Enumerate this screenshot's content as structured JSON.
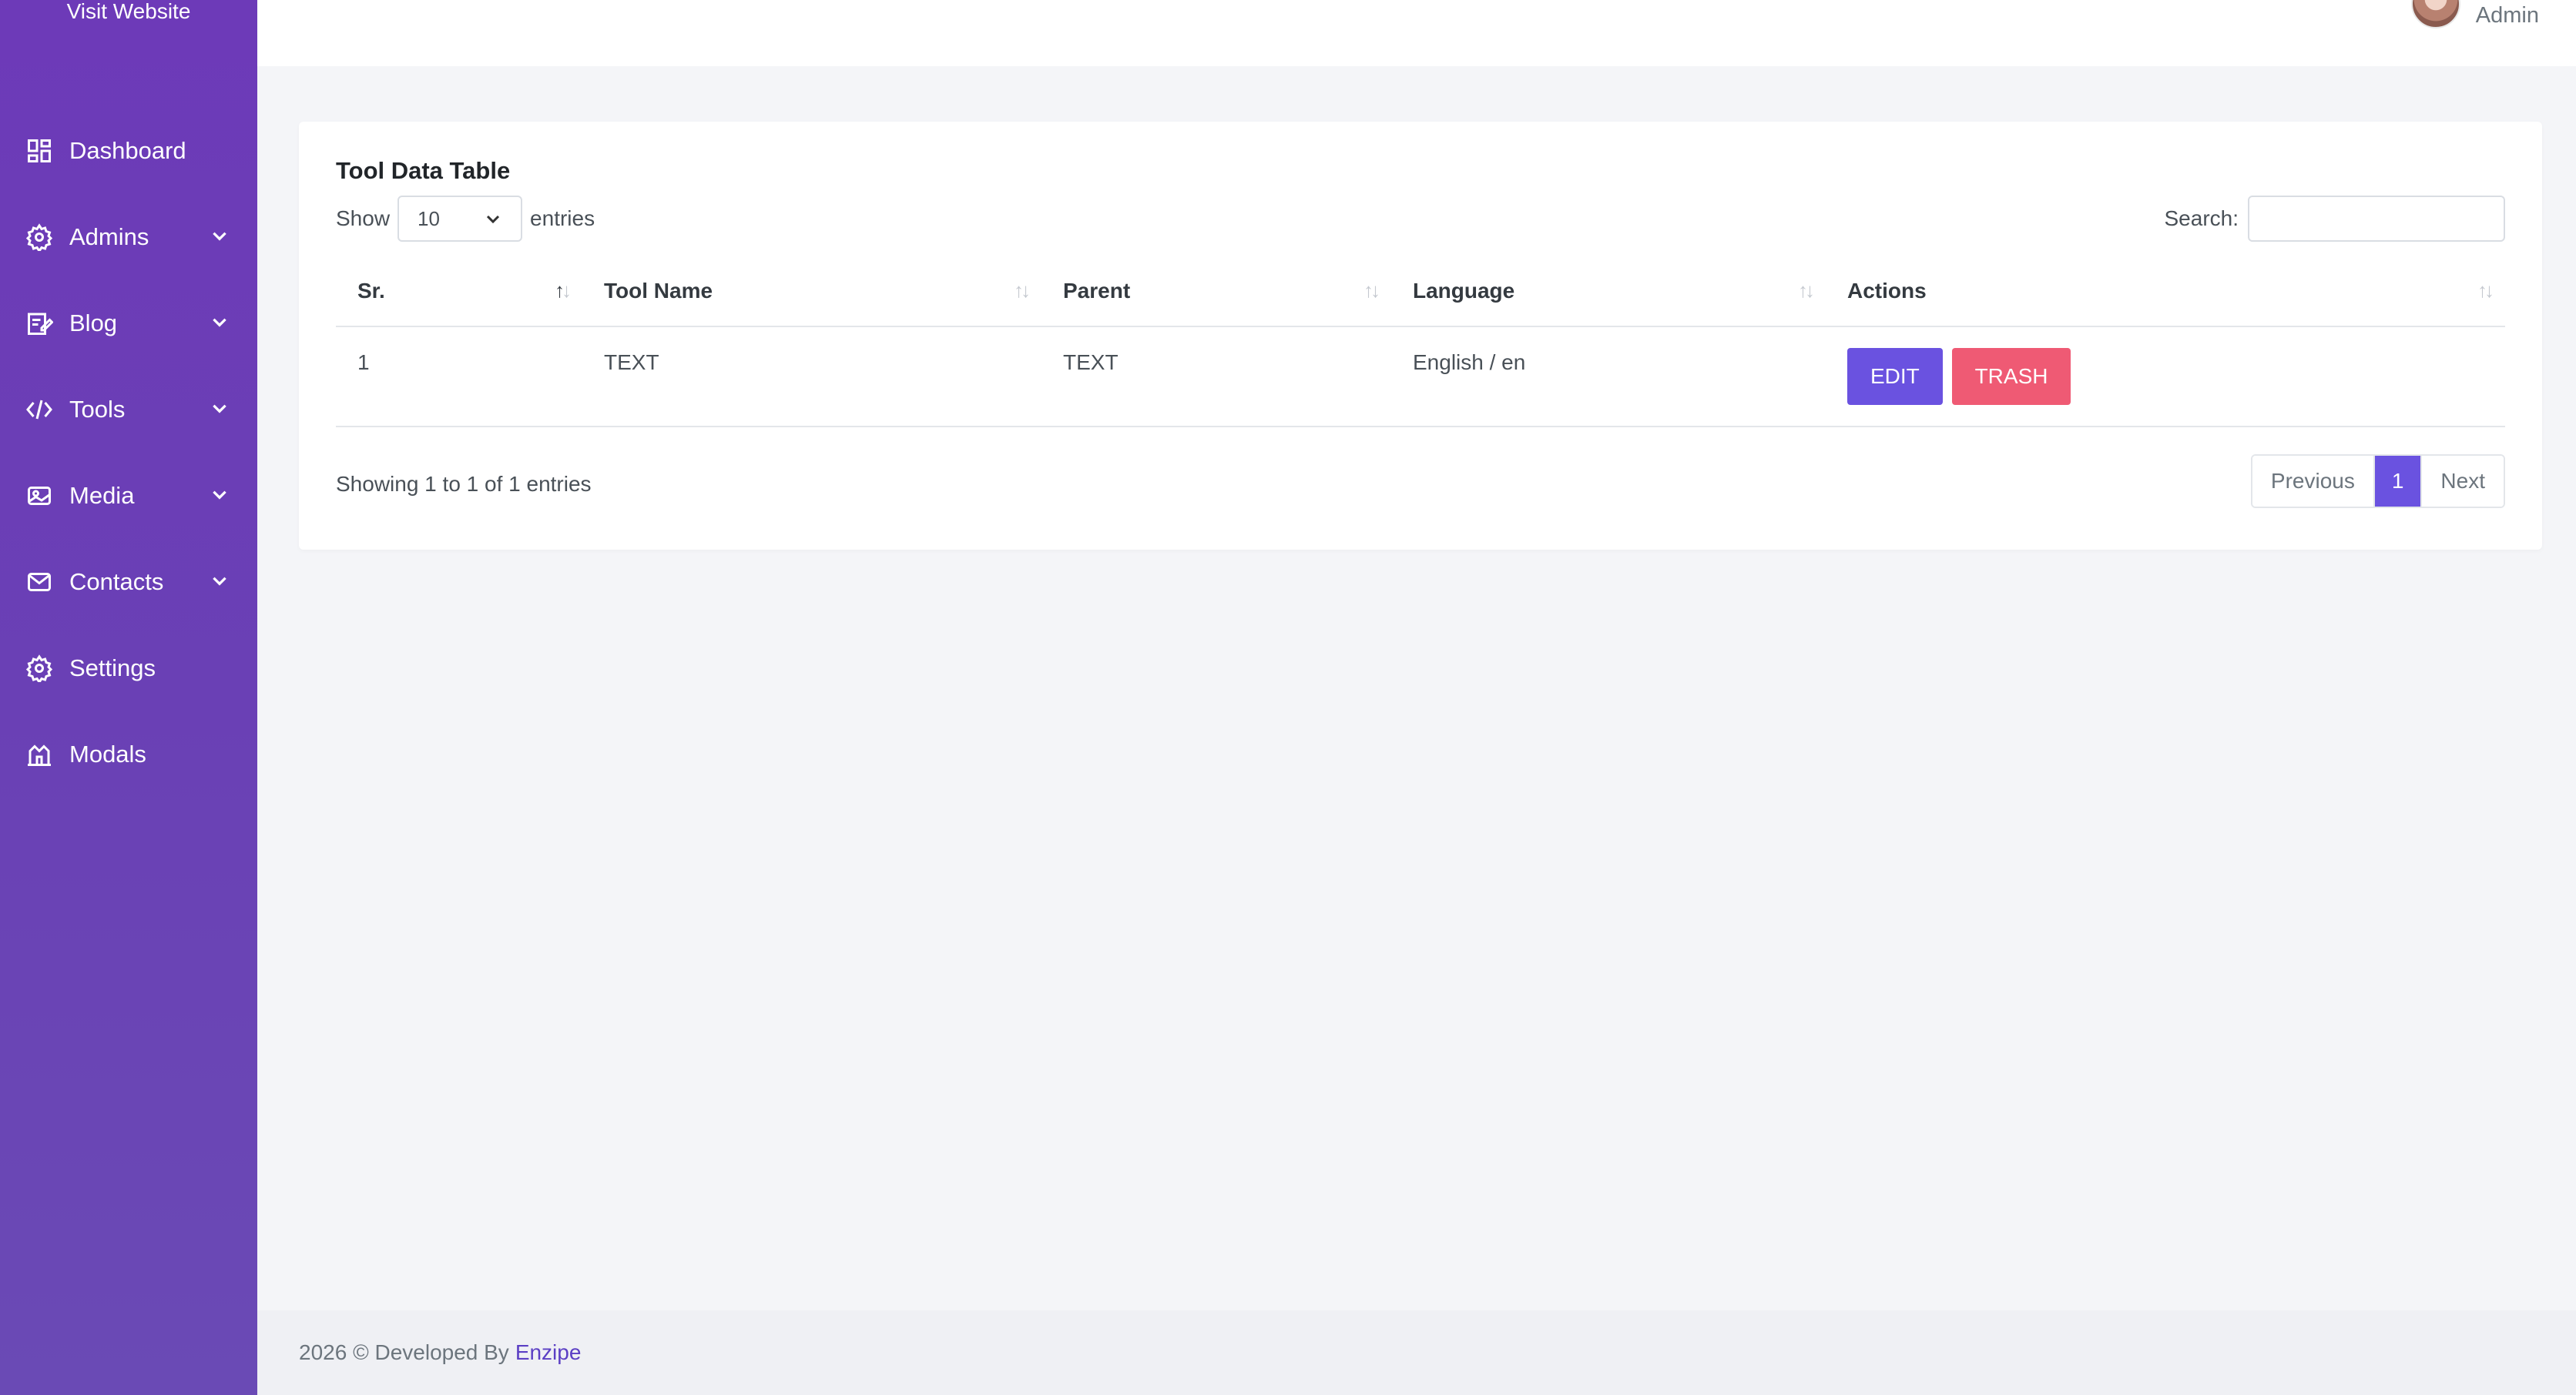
{
  "sidebar": {
    "visit_label": "Visit Website",
    "items": [
      {
        "label": "Dashboard",
        "icon": "dashboard-icon",
        "has_submenu": false
      },
      {
        "label": "Admins",
        "icon": "admins-gear-icon",
        "has_submenu": true
      },
      {
        "label": "Blog",
        "icon": "blog-edit-icon",
        "has_submenu": true
      },
      {
        "label": "Tools",
        "icon": "code-icon",
        "has_submenu": true
      },
      {
        "label": "Media",
        "icon": "media-image-icon",
        "has_submenu": true
      },
      {
        "label": "Contacts",
        "icon": "envelope-icon",
        "has_submenu": true
      },
      {
        "label": "Settings",
        "icon": "gear-icon",
        "has_submenu": false
      },
      {
        "label": "Modals",
        "icon": "modals-icon",
        "has_submenu": false
      }
    ]
  },
  "header": {
    "user_name": "Admin"
  },
  "card": {
    "title": "Tool Data Table",
    "length": {
      "prefix": "Show",
      "value": "10",
      "suffix": "entries"
    },
    "search_label": "Search:",
    "search_value": "",
    "columns": [
      "Sr.",
      "Tool Name",
      "Parent",
      "Language",
      "Actions"
    ],
    "rows": [
      {
        "sr": "1",
        "tool_name": "TEXT",
        "parent": "TEXT",
        "language": "English / en"
      }
    ],
    "actions": {
      "edit": "EDIT",
      "trash": "TRASH"
    },
    "info": "Showing 1 to 1 of 1 entries",
    "pagination": {
      "previous": "Previous",
      "current": "1",
      "next": "Next"
    }
  },
  "footer": {
    "text": "2026 © Developed By",
    "brand": "Enzipe"
  },
  "colors": {
    "sidebar": "#6d3ab8",
    "primary": "#6a52e0",
    "danger": "#ef5a74",
    "background": "#f4f5f8"
  }
}
